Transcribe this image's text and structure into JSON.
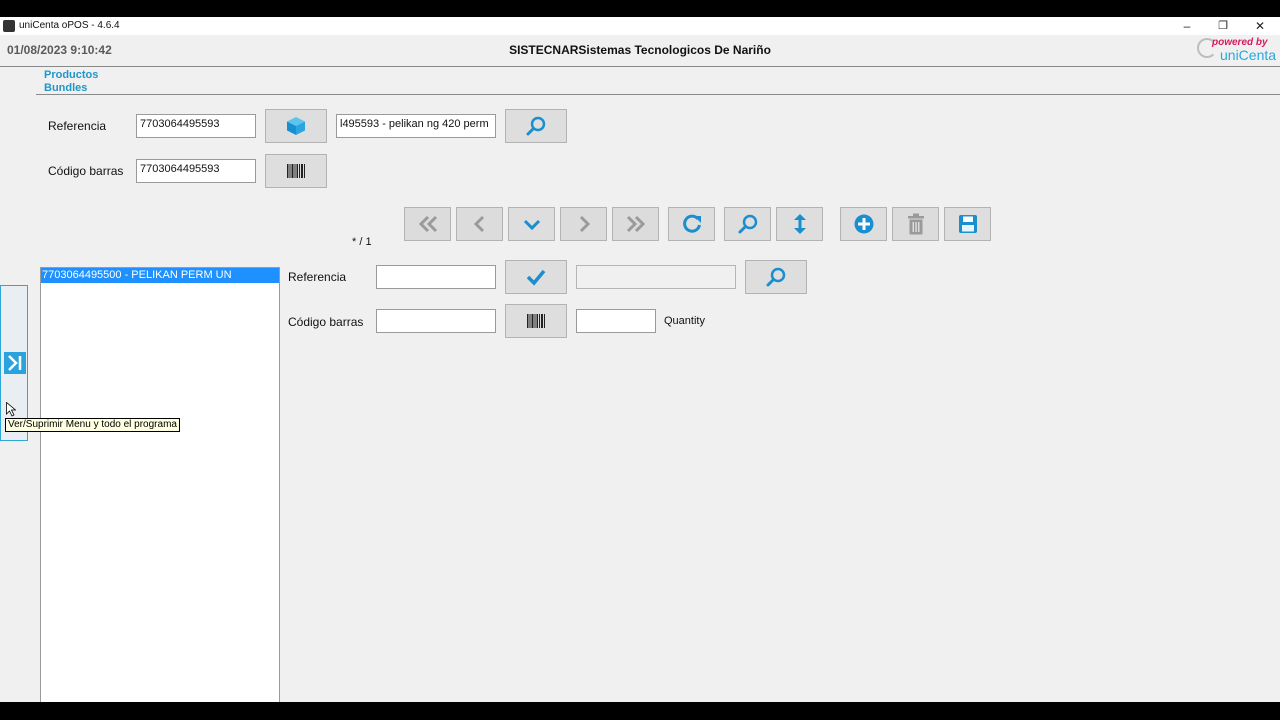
{
  "window": {
    "title": "uniCenta oPOS - 4.6.4"
  },
  "header": {
    "datetime": "01/08/2023 9:10:42",
    "company": "SISTECNARSistemas Tecnologicos De Nariño",
    "logo_powered": "powered by",
    "logo_name": "uniCenta"
  },
  "breadcrumb": {
    "line1": "Productos",
    "line2": "Bundles"
  },
  "product": {
    "ref_label": "Referencia",
    "ref_value": "7703064495593",
    "barcode_label": "Código barras",
    "barcode_value": "7703064495593",
    "name_value": "l495593 - pelikan ng 420 perm"
  },
  "nav": {
    "counter": "* / 1"
  },
  "bundle_list": {
    "items": [
      "7703064495500 - PELIKAN PERM UN"
    ]
  },
  "detail": {
    "ref_label": "Referencia",
    "ref_value": "",
    "barcode_label": "Código barras",
    "barcode_value": "",
    "name_value": "",
    "quantity_value": "",
    "quantity_label": "Quantity"
  },
  "tooltip": {
    "text": "Ver/Suprimir Menu y todo el programa"
  },
  "colors": {
    "accent": "#29a3dd",
    "selection": "#1e90ff",
    "logo_pink": "#d81b60"
  }
}
